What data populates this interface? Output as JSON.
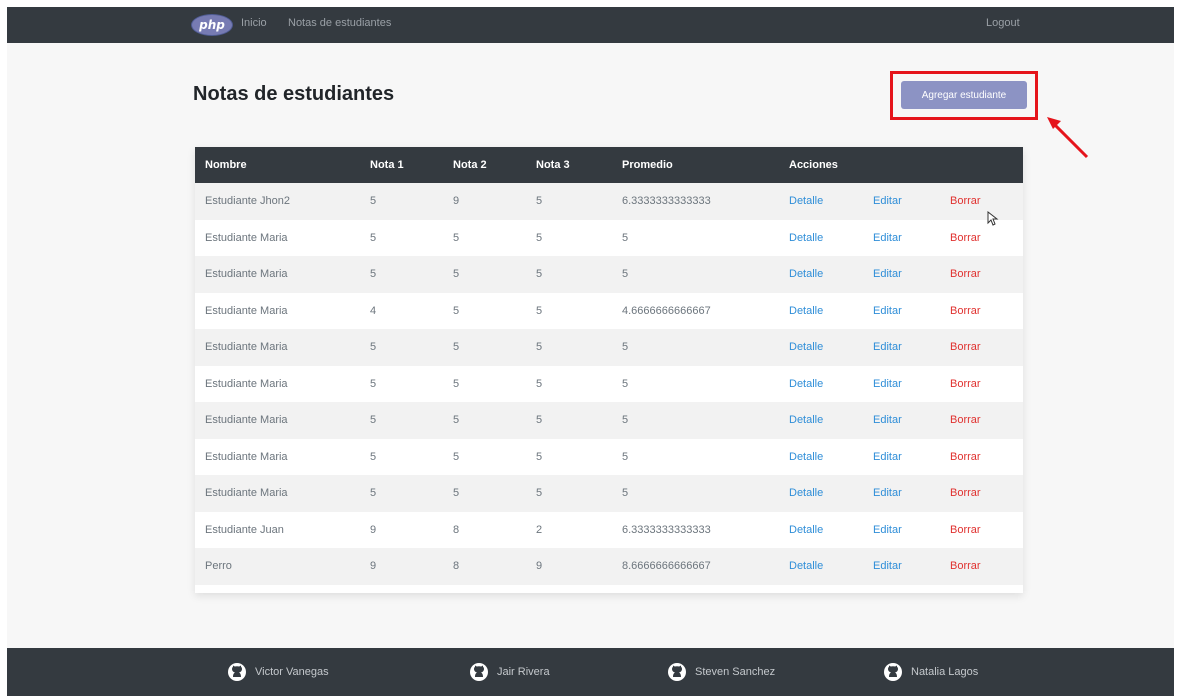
{
  "navbar": {
    "logo_text": "php",
    "home_label": "Inicio",
    "notes_label": "Notas de estudiantes",
    "logout_label": "Logout"
  },
  "page": {
    "title": "Notas de estudiantes",
    "add_button_label": "Agregar estudiante"
  },
  "table": {
    "headers": [
      "Nombre",
      "Nota 1",
      "Nota 2",
      "Nota 3",
      "Promedio",
      "Acciones"
    ],
    "rows": [
      {
        "name": "Estudiante Jhon2",
        "n1": "5",
        "n2": "9",
        "n3": "5",
        "avg": "6.3333333333333",
        "detail": "Detalle",
        "edit": "Editar",
        "delete": "Borrar"
      },
      {
        "name": "Estudiante Maria",
        "n1": "5",
        "n2": "5",
        "n3": "5",
        "avg": "5",
        "detail": "Detalle",
        "edit": "Editar",
        "delete": "Borrar"
      },
      {
        "name": "Estudiante Maria",
        "n1": "5",
        "n2": "5",
        "n3": "5",
        "avg": "5",
        "detail": "Detalle",
        "edit": "Editar",
        "delete": "Borrar"
      },
      {
        "name": "Estudiante Maria",
        "n1": "4",
        "n2": "5",
        "n3": "5",
        "avg": "4.6666666666667",
        "detail": "Detalle",
        "edit": "Editar",
        "delete": "Borrar"
      },
      {
        "name": "Estudiante Maria",
        "n1": "5",
        "n2": "5",
        "n3": "5",
        "avg": "5",
        "detail": "Detalle",
        "edit": "Editar",
        "delete": "Borrar"
      },
      {
        "name": "Estudiante Maria",
        "n1": "5",
        "n2": "5",
        "n3": "5",
        "avg": "5",
        "detail": "Detalle",
        "edit": "Editar",
        "delete": "Borrar"
      },
      {
        "name": "Estudiante Maria",
        "n1": "5",
        "n2": "5",
        "n3": "5",
        "avg": "5",
        "detail": "Detalle",
        "edit": "Editar",
        "delete": "Borrar"
      },
      {
        "name": "Estudiante Maria",
        "n1": "5",
        "n2": "5",
        "n3": "5",
        "avg": "5",
        "detail": "Detalle",
        "edit": "Editar",
        "delete": "Borrar"
      },
      {
        "name": "Estudiante Maria",
        "n1": "5",
        "n2": "5",
        "n3": "5",
        "avg": "5",
        "detail": "Detalle",
        "edit": "Editar",
        "delete": "Borrar"
      },
      {
        "name": "Estudiante Juan",
        "n1": "9",
        "n2": "8",
        "n3": "2",
        "avg": "6.3333333333333",
        "detail": "Detalle",
        "edit": "Editar",
        "delete": "Borrar"
      },
      {
        "name": "Perro",
        "n1": "9",
        "n2": "8",
        "n3": "9",
        "avg": "8.6666666666667",
        "detail": "Detalle",
        "edit": "Editar",
        "delete": "Borrar"
      }
    ]
  },
  "footer": {
    "authors": [
      "Victor Vanegas",
      "Jair Rivera",
      "Steven Sanchez",
      "Natalia Lagos"
    ],
    "icon": "github-icon"
  },
  "colors": {
    "navbar_bg": "#343a40",
    "button_bg": "#8c93c4",
    "link_blue": "#2f8ed8",
    "link_red": "#e0312f",
    "highlight_red": "#e5141b"
  }
}
